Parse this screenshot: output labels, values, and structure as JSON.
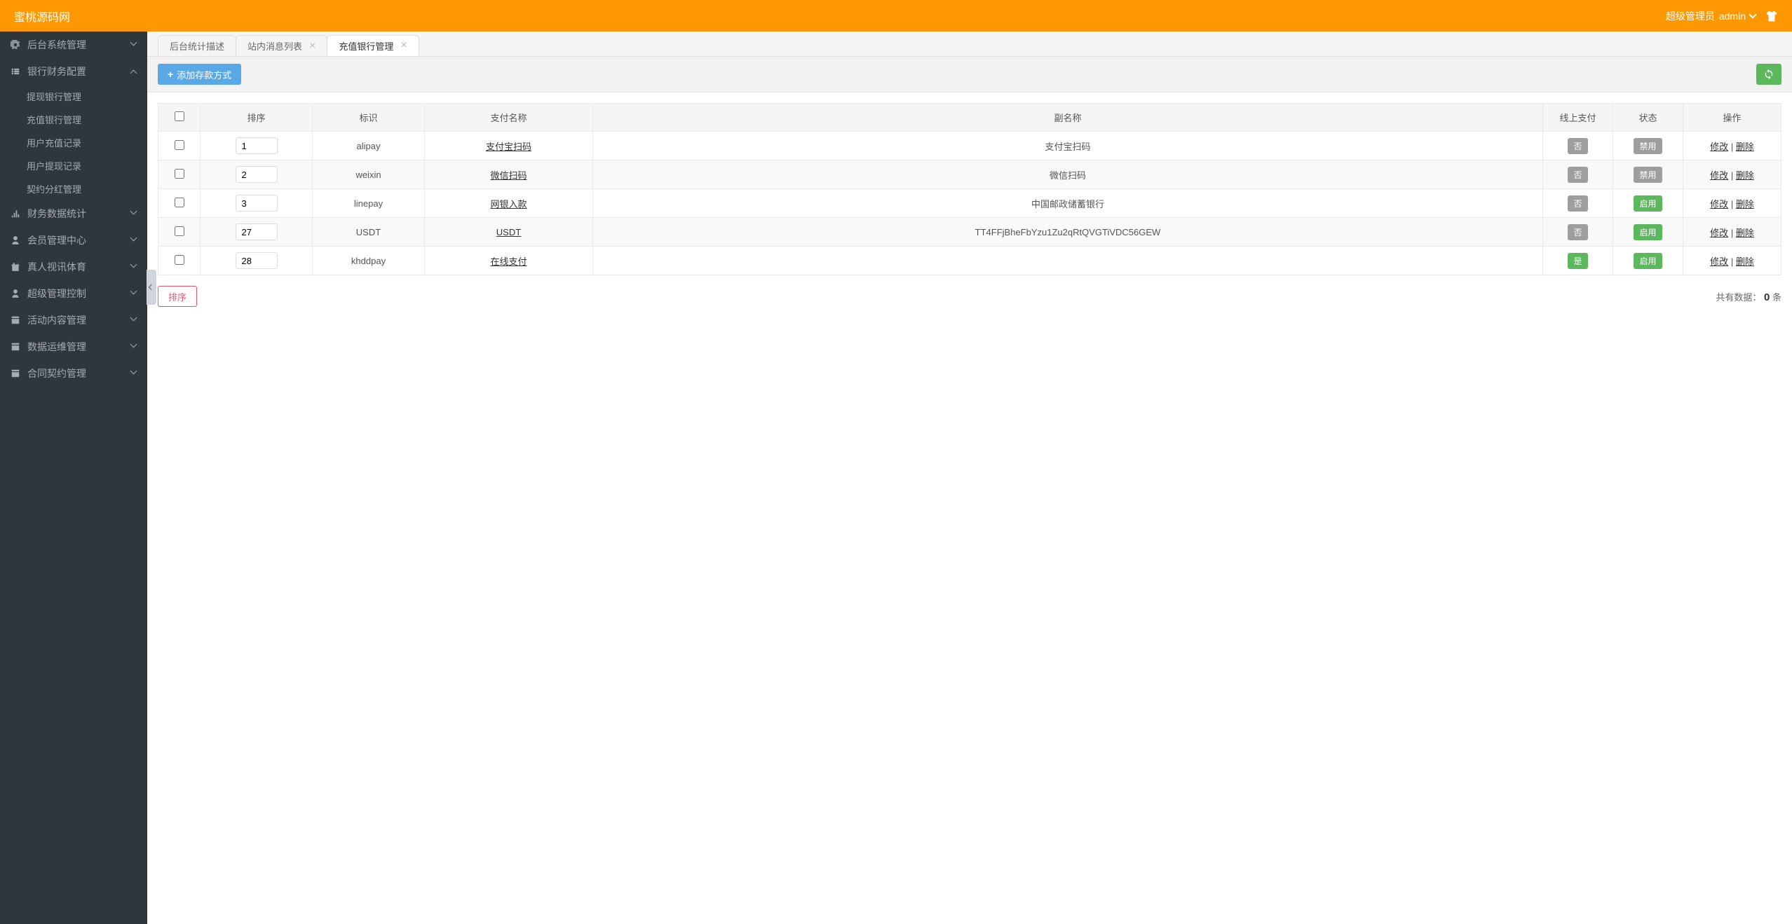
{
  "header": {
    "title": "蜜桃源码网",
    "role": "超级管理员",
    "username": "admin"
  },
  "sidebar": {
    "items": [
      {
        "label": "后台系统管理",
        "icon": "gear",
        "expandable": true,
        "expanded": false
      },
      {
        "label": "银行财务配置",
        "icon": "list",
        "expandable": true,
        "expanded": true,
        "children": [
          {
            "label": "提现银行管理"
          },
          {
            "label": "充值银行管理"
          },
          {
            "label": "用户充值记录"
          },
          {
            "label": "用户提现记录"
          },
          {
            "label": "契约分红管理"
          }
        ]
      },
      {
        "label": "财务数据统计",
        "icon": "chart",
        "expandable": true,
        "expanded": false
      },
      {
        "label": "会员管理中心",
        "icon": "user",
        "expandable": true,
        "expanded": false
      },
      {
        "label": "真人视讯体育",
        "icon": "gift",
        "expandable": true,
        "expanded": false
      },
      {
        "label": "超级管理控制",
        "icon": "person",
        "expandable": true,
        "expanded": false
      },
      {
        "label": "活动内容管理",
        "icon": "window",
        "expandable": true,
        "expanded": false
      },
      {
        "label": "数据运维管理",
        "icon": "window",
        "expandable": true,
        "expanded": false
      },
      {
        "label": "合同契约管理",
        "icon": "window",
        "expandable": true,
        "expanded": false
      }
    ]
  },
  "tabs": [
    {
      "label": "后台统计描述",
      "closable": false,
      "active": false
    },
    {
      "label": "站内消息列表",
      "closable": true,
      "active": false
    },
    {
      "label": "充值银行管理",
      "closable": true,
      "active": true
    }
  ],
  "toolbar": {
    "add_button_label": "添加存款方式"
  },
  "table": {
    "headers": {
      "sort": "排序",
      "flag": "标识",
      "payname": "支付名称",
      "subname": "副名称",
      "online": "线上支付",
      "status": "状态",
      "action": "操作"
    },
    "rows": [
      {
        "sort": "1",
        "flag": "alipay",
        "payname": "支付宝扫码",
        "subname": "支付宝扫码",
        "online": "否",
        "online_class": "gray",
        "status": "禁用",
        "status_class": "gray"
      },
      {
        "sort": "2",
        "flag": "weixin",
        "payname": "微信扫码",
        "subname": "微信扫码",
        "online": "否",
        "online_class": "gray",
        "status": "禁用",
        "status_class": "gray"
      },
      {
        "sort": "3",
        "flag": "linepay",
        "payname": "网银入款",
        "subname": "中国邮政储蓄银行",
        "online": "否",
        "online_class": "gray",
        "status": "启用",
        "status_class": "green"
      },
      {
        "sort": "27",
        "flag": "USDT",
        "payname": "USDT",
        "subname": "TT4FFjBheFbYzu1Zu2qRtQVGTiVDC56GEW",
        "online": "否",
        "online_class": "gray",
        "status": "启用",
        "status_class": "green"
      },
      {
        "sort": "28",
        "flag": "khddpay",
        "payname": "在线支付",
        "subname": "",
        "online": "是",
        "online_class": "green",
        "status": "启用",
        "status_class": "green"
      }
    ],
    "actions": {
      "edit": "修改",
      "delete": "删除"
    }
  },
  "footer": {
    "sort_button": "排序",
    "data_count_prefix": "共有数据：",
    "data_count_value": "0",
    "data_count_suffix": " 条"
  }
}
